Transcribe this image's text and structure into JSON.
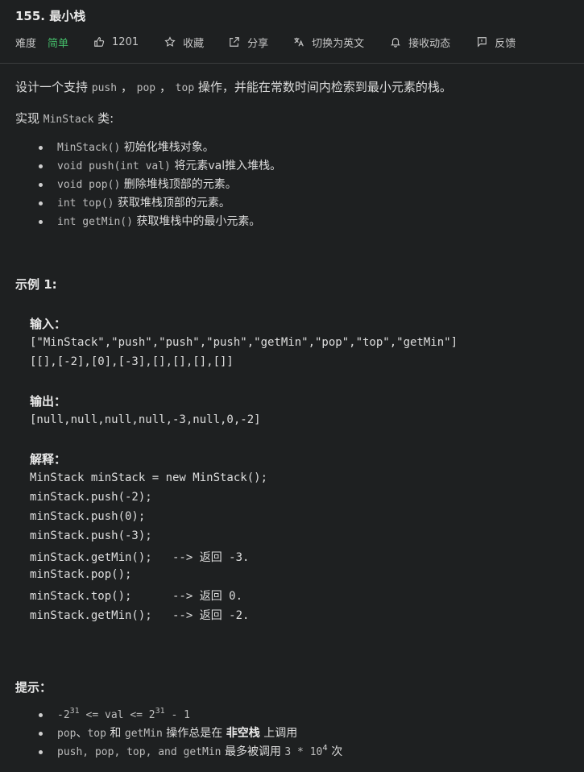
{
  "problem": {
    "title": "155. 最小栈"
  },
  "toolbar": {
    "difficulty_label": "难度",
    "difficulty_value": "简单",
    "like_count": "1201",
    "favorite_label": "收藏",
    "share_label": "分享",
    "translate_label": "切换为英文",
    "subscribe_label": "接收动态",
    "feedback_label": "反馈",
    "difficulty_color": "#44b968"
  },
  "description": {
    "line1_a": "设计一个支持 ",
    "line1_push": "push",
    "line1_sep1": " ， ",
    "line1_pop": "pop",
    "line1_sep2": " ， ",
    "line1_top": "top",
    "line1_b": " 操作，并能在常数时间内检索到最小元素的栈。",
    "line2_a": "实现 ",
    "line2_code": "MinStack",
    "line2_b": " 类:",
    "methods": [
      {
        "code": "MinStack()",
        "text": " 初始化堆栈对象。"
      },
      {
        "code": "void push(int val)",
        "text": " 将元素val推入堆栈。"
      },
      {
        "code": "void pop()",
        "text": " 删除堆栈顶部的元素。"
      },
      {
        "code": "int top()",
        "text": " 获取堆栈顶部的元素。"
      },
      {
        "code": "int getMin()",
        "text": " 获取堆栈中的最小元素。"
      }
    ]
  },
  "example": {
    "heading": "示例 1:",
    "input_label": "输入：",
    "input_line1": "[\"MinStack\",\"push\",\"push\",\"push\",\"getMin\",\"pop\",\"top\",\"getMin\"]",
    "input_line2": "[[],[-2],[0],[-3],[],[],[],[]]",
    "output_label": "输出：",
    "output_line": "[null,null,null,null,-3,null,0,-2]",
    "explain_label": "解释：",
    "explain_lines": [
      {
        "code": "MinStack minStack = new MinStack();",
        "comment": ""
      },
      {
        "code": "minStack.push(-2);",
        "comment": ""
      },
      {
        "code": "minStack.push(0);",
        "comment": ""
      },
      {
        "code": "minStack.push(-3);",
        "comment": ""
      },
      {
        "code": "minStack.getMin();   --> ",
        "comment": "返回",
        "tail": " -3."
      },
      {
        "code": "minStack.pop();",
        "comment": ""
      },
      {
        "code": "minStack.top();      --> ",
        "comment": "返回",
        "tail": " 0."
      },
      {
        "code": "minStack.getMin();   --> ",
        "comment": "返回",
        "tail": " -2."
      }
    ]
  },
  "hints": {
    "heading": "提示：",
    "h1_a": "-2",
    "h1_exp1": "31",
    "h1_b": " <= val <= 2",
    "h1_exp2": "31",
    "h1_c": " - 1",
    "h2_pop": "pop",
    "h2_sep": "、",
    "h2_top": "top",
    "h2_and": " 和 ",
    "h2_getmin": "getMin",
    "h2_text": " 操作总是在 ",
    "h2_strong": "非空栈",
    "h2_tail": " 上调用",
    "h3_code": "push, pop, top, and getMin",
    "h3_text": " 最多被调用 ",
    "h3_num": "3 * 10",
    "h3_exp": "4",
    "h3_tail": " 次"
  }
}
